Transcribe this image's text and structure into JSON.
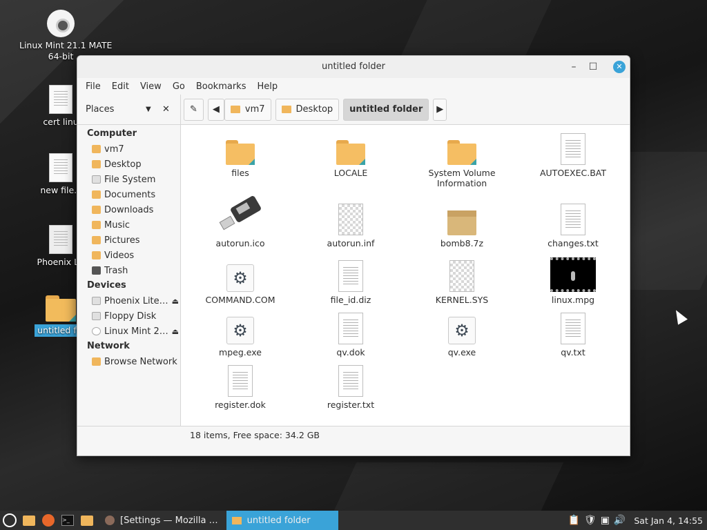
{
  "desktop": {
    "icons": [
      {
        "label": "Linux Mint 21.1 MATE\n64-bit",
        "line1": "Linux Mint 21.1 MATE",
        "line2": "64-bit",
        "icon": "disc-icon"
      },
      {
        "label": "cert linu",
        "icon": "document-icon"
      },
      {
        "label": "new file.s",
        "icon": "document-icon"
      },
      {
        "label": "Phoenix Lit",
        "icon": "drive-icon"
      },
      {
        "label": "untitled fol",
        "icon": "folder-icon"
      }
    ]
  },
  "window": {
    "title": "untitled folder",
    "menu": [
      "File",
      "Edit",
      "View",
      "Go",
      "Bookmarks",
      "Help"
    ],
    "toolbar": {
      "places_label": "Places",
      "breadcrumbs": [
        "vm7",
        "Desktop",
        "untitled folder"
      ]
    },
    "sidebar": {
      "computer_label": "Computer",
      "computer_items": [
        "vm7",
        "Desktop",
        "File System",
        "Documents",
        "Downloads",
        "Music",
        "Pictures",
        "Videos",
        "Trash"
      ],
      "devices_label": "Devices",
      "device_items": [
        "Phoenix Lite…",
        "Floppy Disk",
        "Linux Mint 2…"
      ],
      "network_label": "Network",
      "network_items": [
        "Browse Network"
      ]
    },
    "files": [
      {
        "name": "files",
        "type": "folder"
      },
      {
        "name": "LOCALE",
        "type": "folder"
      },
      {
        "name": "System Volume Information",
        "line1": "System Volume",
        "line2": "Information",
        "type": "folder"
      },
      {
        "name": "AUTOEXEC.BAT",
        "type": "text"
      },
      {
        "name": "autorun.ico",
        "type": "usb"
      },
      {
        "name": "autorun.inf",
        "type": "binary"
      },
      {
        "name": "bomb8.7z",
        "type": "archive"
      },
      {
        "name": "changes.txt",
        "type": "text"
      },
      {
        "name": "COMMAND.COM",
        "type": "executable"
      },
      {
        "name": "file_id.diz",
        "type": "text"
      },
      {
        "name": "KERNEL.SYS",
        "type": "binary"
      },
      {
        "name": "linux.mpg",
        "type": "video"
      },
      {
        "name": "mpeg.exe",
        "type": "executable"
      },
      {
        "name": "qv.dok",
        "type": "text"
      },
      {
        "name": "qv.exe",
        "type": "executable"
      },
      {
        "name": "qv.txt",
        "type": "text"
      },
      {
        "name": "register.dok",
        "type": "text"
      },
      {
        "name": "register.txt",
        "type": "text"
      }
    ],
    "status": "18 items, Free space: 34.2 GB"
  },
  "taskbar": {
    "tasks": [
      "[Settings — Mozilla …",
      "untitled folder"
    ],
    "clock": "Sat Jan  4, 14:55"
  },
  "colors": {
    "accent": "#3aa3d8",
    "folder": "#f5be63"
  }
}
